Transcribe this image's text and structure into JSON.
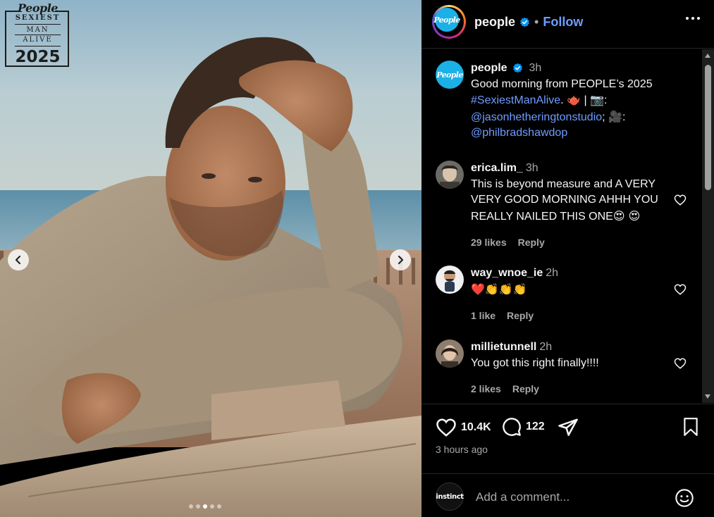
{
  "photo": {
    "badge": {
      "brand": "People",
      "line1": "SEXIEST",
      "line2": "MAN",
      "line3": "ALIVE",
      "year": "2025"
    },
    "carousel": {
      "slides": 5,
      "active_index": 2
    }
  },
  "header": {
    "username": "people",
    "separator": "•",
    "follow_label": "Follow",
    "avatar_text": "People"
  },
  "caption": {
    "username": "people",
    "time": "3h",
    "text_1": "Good morning from PEOPLE’s 2025",
    "hashtag": "#SexiestManAlive",
    "text_2": ".",
    "emoji_1": "🫖",
    "text_3": " | ",
    "emoji_2": "📷",
    "text_4": ":",
    "mention_1": "@jasonhetheringtonstudio",
    "text_5": "; ",
    "emoji_3": "🎥",
    "text_6": ":",
    "mention_2": "@philbradshawdop"
  },
  "comments": [
    {
      "username": "erica.lim_",
      "time": "3h",
      "text": "This is beyond measure and A VERY VERY GOOD MORNING AHHH YOU REALLY NAILED THIS ONE",
      "emojis": "😍 😍",
      "likes": "29 likes",
      "reply": "Reply"
    },
    {
      "username": "way_wnoe_ie",
      "time": "2h",
      "text": "",
      "emojis": "❤️👏👏👏",
      "likes": "1 like",
      "reply": "Reply"
    },
    {
      "username": "millietunnell",
      "time": "2h",
      "text": "You got this right finally!!!!",
      "emojis": "",
      "likes": "2 likes",
      "reply": "Reply"
    }
  ],
  "actions": {
    "like_count": "10.4K",
    "comment_count": "122",
    "timestamp": "3 hours ago"
  },
  "composer": {
    "avatar_text": "instinct",
    "placeholder": "Add a comment..."
  },
  "colors": {
    "link": "#6f9cff",
    "verified": "#0095f6",
    "people_blue": "#1bb0e6",
    "background": "#000000"
  }
}
